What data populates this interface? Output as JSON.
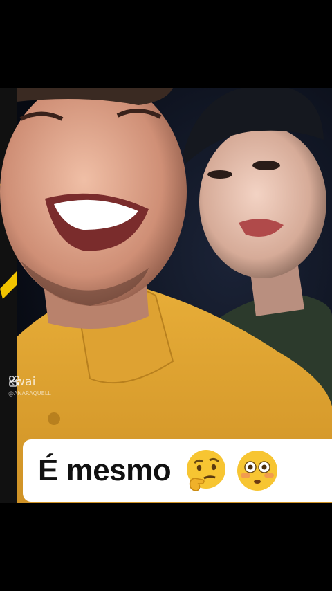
{
  "watermark": {
    "brand": "kwai",
    "handle": "@ANARAQUELL"
  },
  "caption": {
    "text": "É mesmo",
    "emojis": [
      "thinking-face-emoji",
      "flushed-face-emoji"
    ]
  },
  "colors": {
    "shirt_yellow": "#e0a531",
    "accent_yellow": "#f2c400",
    "caption_bg": "#ffffff"
  }
}
